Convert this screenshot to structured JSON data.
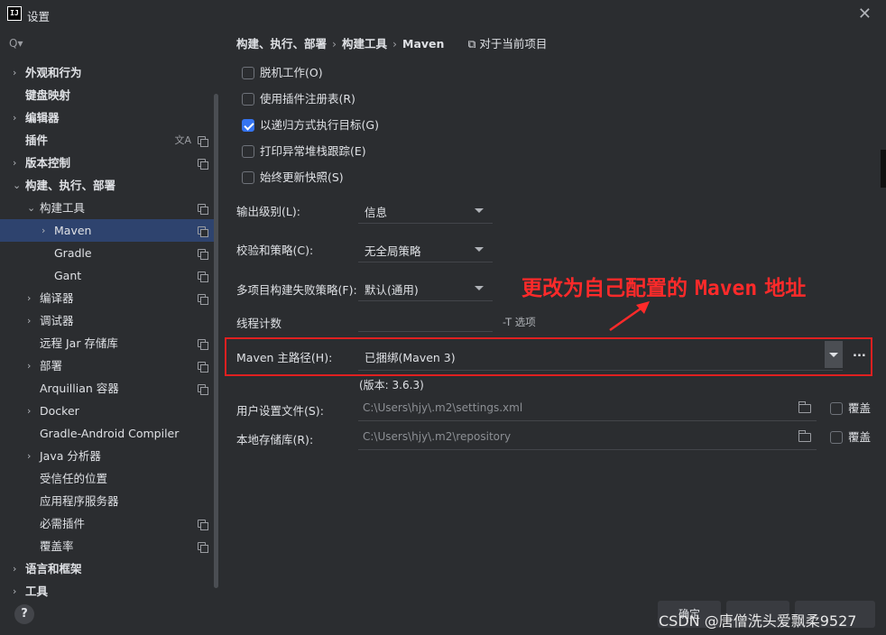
{
  "window": {
    "title": "设置",
    "close": "✕"
  },
  "sidebar": {
    "search_icon": "Q▾",
    "items": [
      {
        "label": "外观和行为",
        "chev": "›",
        "bold": true
      },
      {
        "label": "键盘映射",
        "bold": true
      },
      {
        "label": "编辑器",
        "chev": "›",
        "bold": true
      },
      {
        "label": "插件",
        "bold": true
      },
      {
        "label": "版本控制",
        "chev": "›",
        "bold": true
      },
      {
        "label": "构建、执行、部署",
        "chev": "⌄",
        "bold": true
      },
      {
        "label": "构建工具",
        "chev": "⌄"
      },
      {
        "label": "Maven",
        "chev": "›"
      },
      {
        "label": "Gradle"
      },
      {
        "label": "Gant"
      },
      {
        "label": "编译器",
        "chev": "›"
      },
      {
        "label": "调试器",
        "chev": "›"
      },
      {
        "label": "远程 Jar 存储库"
      },
      {
        "label": "部署",
        "chev": "›"
      },
      {
        "label": "Arquillian 容器"
      },
      {
        "label": "Docker",
        "chev": "›"
      },
      {
        "label": "Gradle-Android Compiler"
      },
      {
        "label": "Java 分析器",
        "chev": "›"
      },
      {
        "label": "受信任的位置"
      },
      {
        "label": "应用程序服务器"
      },
      {
        "label": "必需插件"
      },
      {
        "label": "覆盖率"
      },
      {
        "label": "语言和框架",
        "chev": "›",
        "bold": true
      },
      {
        "label": "工具",
        "chev": "›",
        "bold": true
      }
    ],
    "translate_icon": "文A",
    "help": "?"
  },
  "breadcrumb": {
    "part1": "构建、执行、部署",
    "sep": "›",
    "part2": "构建工具",
    "part3": "Maven",
    "project_scope": "⧉ 对于当前项目"
  },
  "options": {
    "offline": "脱机工作(O)",
    "plugin_registry": "使用插件注册表(R)",
    "recursive": "以递归方式执行目标(G)",
    "stacktrace": "打印异常堆栈跟踪(E)",
    "always_update": "始终更新快照(S)"
  },
  "fields": {
    "output_level_label": "输出级别(L):",
    "output_level_value": "信息",
    "checksum_label": "校验和策略(C):",
    "checksum_value": "无全局策略",
    "fail_label": "多项目构建失败策略(F):",
    "fail_value": "默认(通用)",
    "threads_label": "线程计数",
    "threads_hint": "-T 选项",
    "maven_home_label": "Maven 主路径(H):",
    "maven_home_value": "已捆绑(Maven 3)",
    "maven_home_more": "...",
    "version": "(版本: 3.6.3)",
    "user_settings_label": "用户设置文件(S):",
    "user_settings_value": "C:\\Users\\hjy\\.m2\\settings.xml",
    "local_repo_label": "本地存储库(R):",
    "local_repo_value": "C:\\Users\\hjy\\.m2\\repository",
    "override_label": "覆盖"
  },
  "annotation": {
    "text_before": "更改为自己配置的 ",
    "text_maven": "Maven",
    "text_after": " 地址",
    "color": "#ff2a2a"
  },
  "footer": {
    "ok": "确定",
    "watermark": "CSDN @唐僧洗头爱飘柔9527"
  },
  "colors": {
    "background": "#2b2d30",
    "selection": "#2e436e",
    "accent": "#3574f0",
    "highlight": "#e02020"
  }
}
